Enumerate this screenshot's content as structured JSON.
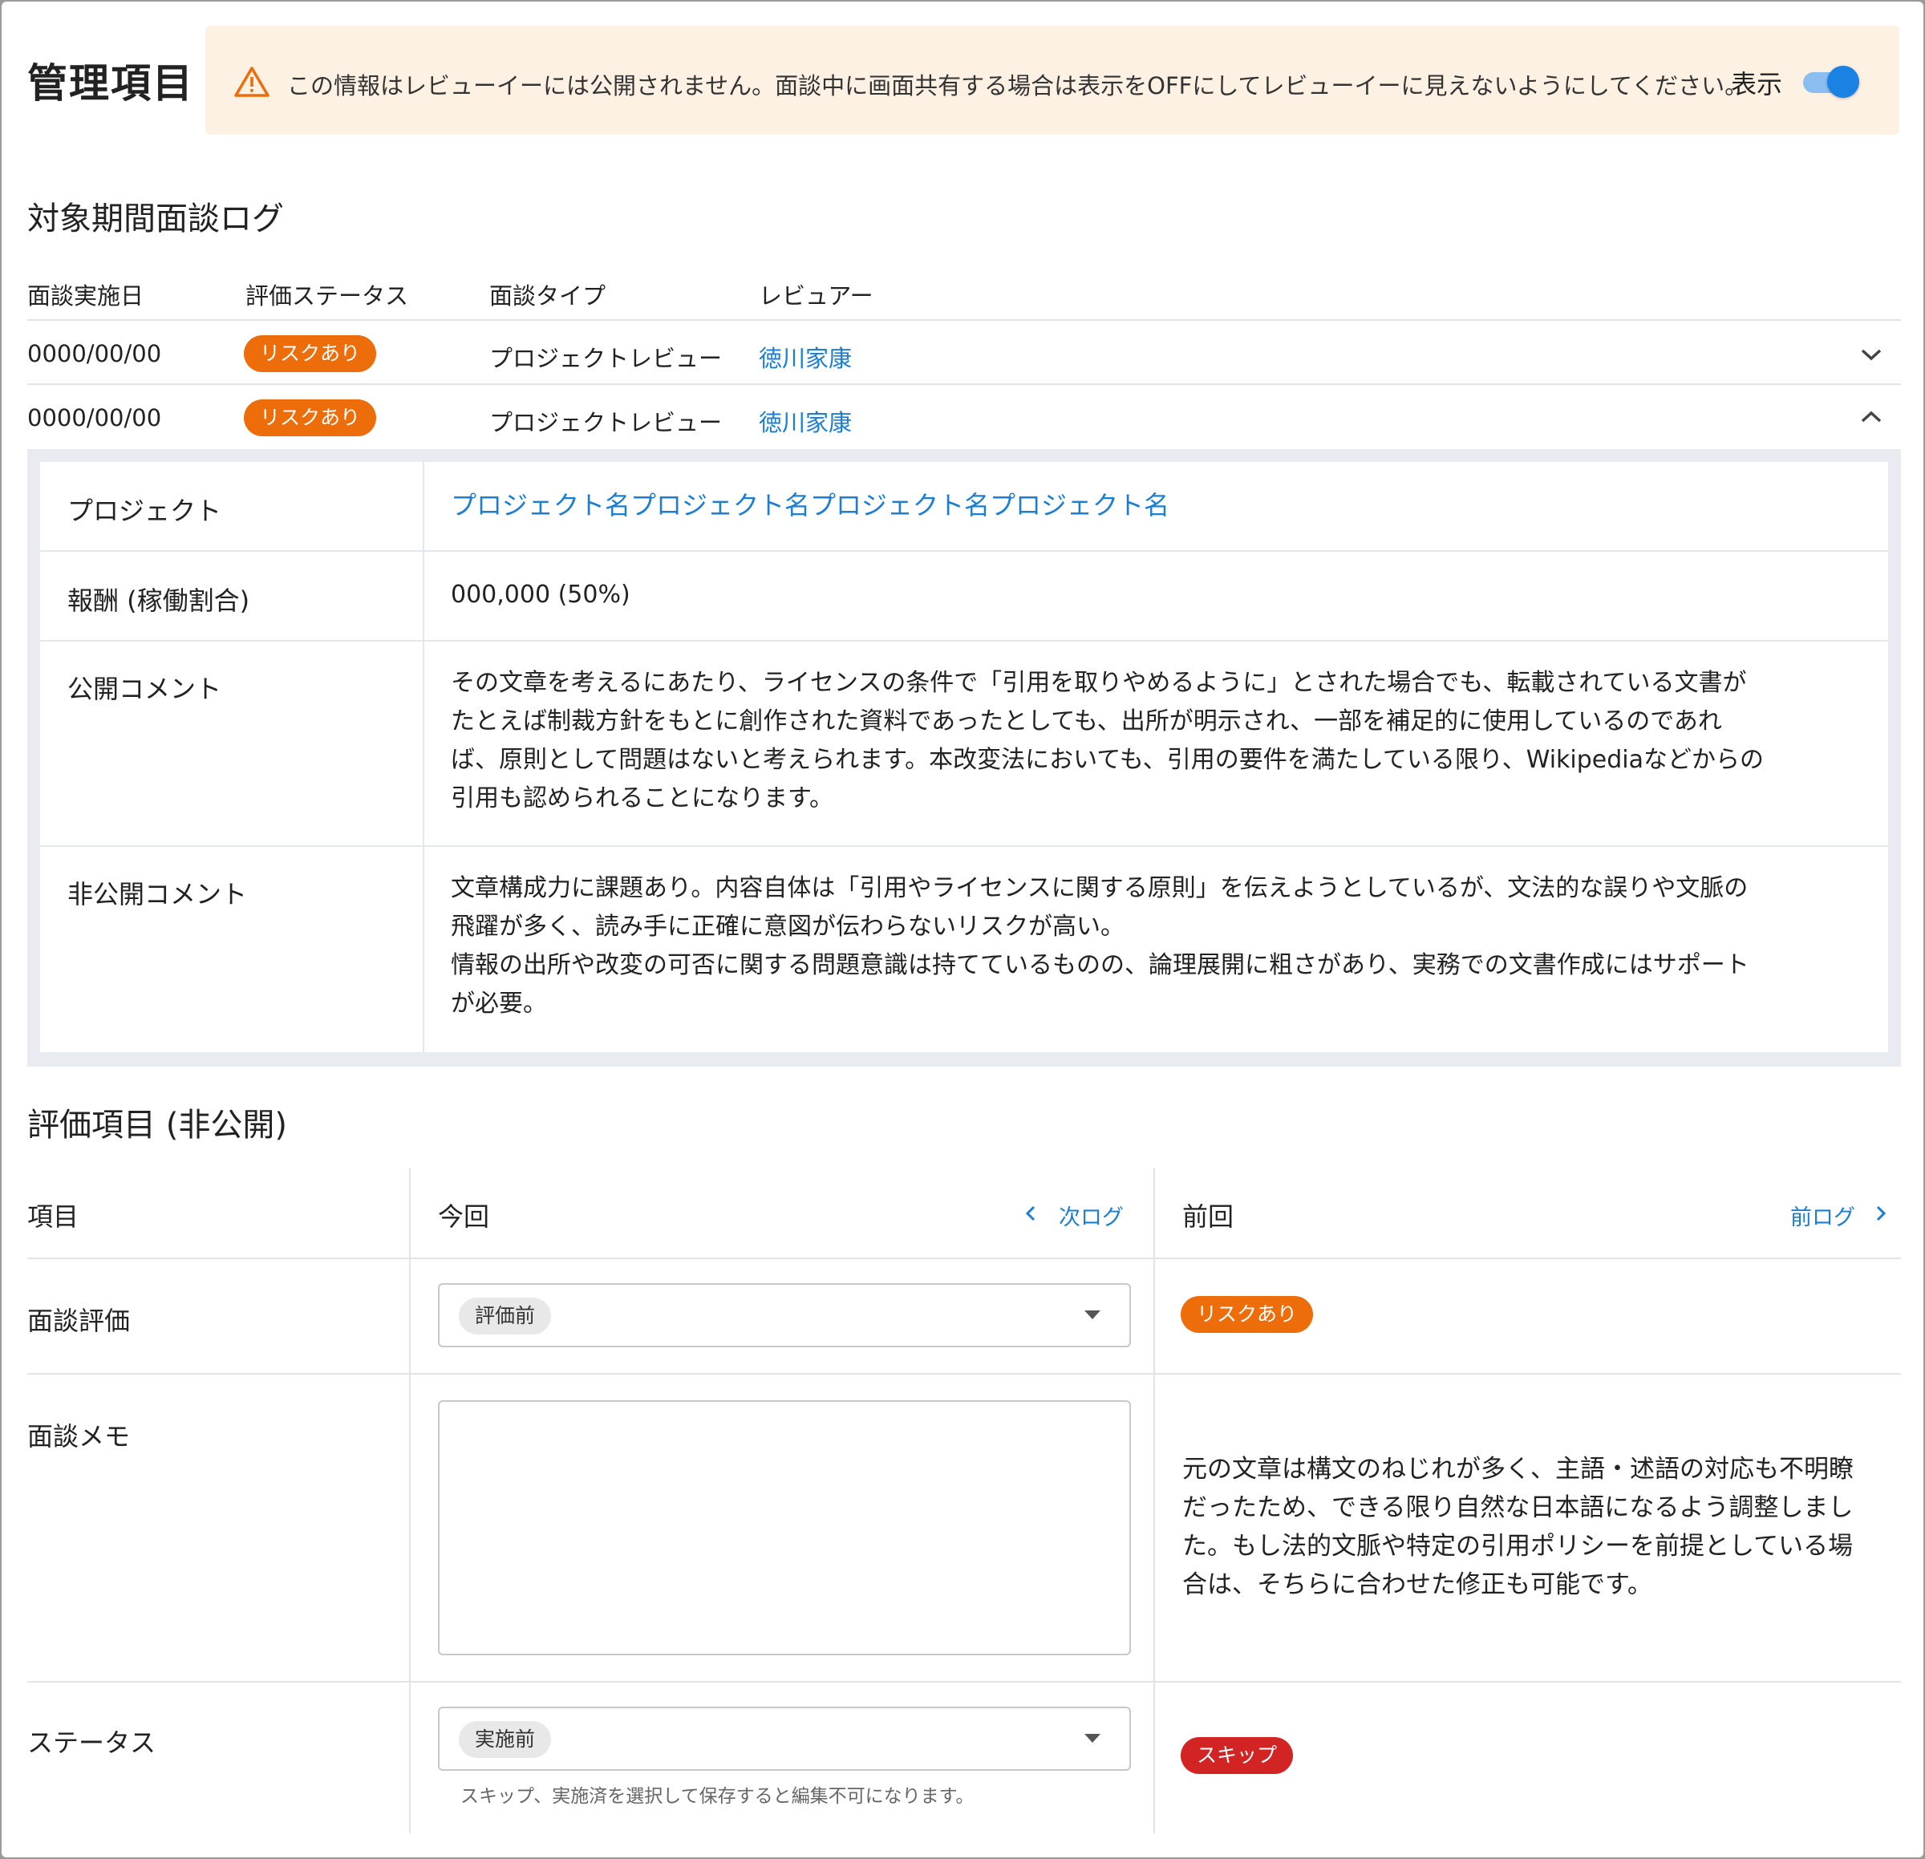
{
  "header": {
    "title": "管理項目",
    "warning_text": "この情報はレビューイーには公開されません。面談中に画面共有する場合は表示をOFFにしてレビューイーに見えないようにしてください。",
    "display_label": "表示",
    "display_toggle_on": true
  },
  "log_section": {
    "title": "対象期間面談ログ",
    "columns": [
      "面談実施日",
      "評価ステータス",
      "面談タイプ",
      "レビュアー"
    ],
    "rows": [
      {
        "date": "0000/00/00",
        "status": "リスクあり",
        "type": "プロジェクトレビュー",
        "reviewer": "徳川家康",
        "expanded": false
      },
      {
        "date": "0000/00/00",
        "status": "リスクあり",
        "type": "プロジェクトレビュー",
        "reviewer": "徳川家康",
        "expanded": true
      }
    ]
  },
  "detail": {
    "project_label": "プロジェクト",
    "project_value": "プロジェクト名プロジェクト名プロジェクト名プロジェクト名",
    "reward_label": "報酬 (稼働割合)",
    "reward_value": "000,000 (50%)",
    "public_comment_label": "公開コメント",
    "public_comment_lines": [
      "その文章を考えるにあたり、ライセンスの条件で「引用を取りやめるように」とされた場合でも、転載されている文書が",
      "たとえば制裁方針をもとに創作された資料であったとしても、出所が明示され、一部を補足的に使用しているのであれ",
      "ば、原則として問題はないと考えられます。本改変法においても、引用の要件を満たしている限り、Wikipediaなどからの",
      "引用も認められることになります。"
    ],
    "private_comment_label": "非公開コメント",
    "private_comment_lines": [
      "文章構成力に課題あり。内容自体は「引用やライセンスに関する原則」を伝えようとしているが、文法的な誤りや文脈の",
      "飛躍が多く、読み手に正確に意図が伝わらないリスクが高い。",
      "情報の出所や改変の可否に関する問題意識は持てているものの、論理展開に粗さがあり、実務での文書作成にはサポート",
      "が必要。"
    ]
  },
  "evaluation": {
    "title": "評価項目 (非公開)",
    "col_item": "項目",
    "col_current": "今回",
    "next_log": "次ログ",
    "col_previous": "前回",
    "prev_log": "前ログ",
    "rating_label": "面談評価",
    "rating_current": "評価前",
    "rating_previous": "リスクあり",
    "memo_label": "面談メモ",
    "memo_current": "",
    "memo_previous_lines": [
      "元の文章は構文のねじれが多く、主語・述語の対応も不明瞭",
      "だったため、できる限り自然な日本語になるよう調整しまし",
      "た。もし法的文脈や特定の引用ポリシーを前提としている場",
      "合は、そちらに合わせた修正も可能です。"
    ],
    "status_label": "ステータス",
    "status_current": "実施前",
    "status_hint": "スキップ、実施済を選択して保存すると編集不可になります。",
    "status_previous": "スキップ"
  },
  "colors": {
    "accent_blue": "#1a7fd4",
    "risk_orange": "#ee6d0b",
    "skip_red": "#d32424",
    "warning_bg": "#fdf1e3"
  }
}
